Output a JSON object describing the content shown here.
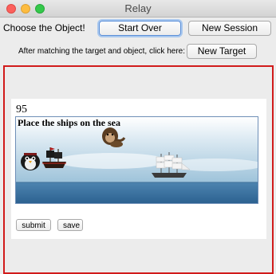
{
  "window": {
    "title": "Relay"
  },
  "toolbar": {
    "choose_label": "Choose the Object!",
    "start_over": "Start Over",
    "new_session": "New Session",
    "hint": "After matching the target and object, click here:",
    "new_target": "New Target"
  },
  "task": {
    "score": "95",
    "instruction": "Place the ships on the sea",
    "submit": "submit",
    "save": "save"
  },
  "colors": {
    "panel_border": "#d11b1b",
    "focus_ring": "#5b8fd8"
  },
  "icons": [
    "close-icon",
    "minimize-icon",
    "zoom-icon",
    "penguin-sprite",
    "pirate-ship-sprite",
    "monkey-sprite",
    "sailing-ship-sprite"
  ]
}
